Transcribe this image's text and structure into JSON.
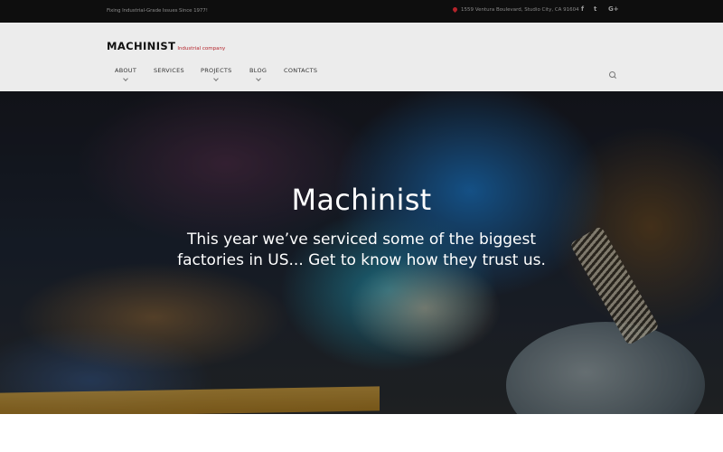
{
  "topbar": {
    "tagline": "Fixing Industrial-Grade Issues Since 1977!",
    "address": "1559 Ventura Boulevard, Studio City, CA 91604",
    "address_icon": "map-pin-icon",
    "social": [
      {
        "name": "facebook-icon",
        "glyph": "f"
      },
      {
        "name": "twitter-icon",
        "glyph": "t"
      },
      {
        "name": "google-plus-icon",
        "glyph": "G+"
      }
    ]
  },
  "header": {
    "brand": "MACHINIST",
    "brand_sub": "Industrial company",
    "nav": [
      {
        "label": "ABOUT",
        "has_dropdown": true
      },
      {
        "label": "SERVICES",
        "has_dropdown": false
      },
      {
        "label": "PROJECTS",
        "has_dropdown": true
      },
      {
        "label": "BLOG",
        "has_dropdown": true
      },
      {
        "label": "CONTACTS",
        "has_dropdown": false
      }
    ],
    "search_icon": "search-icon"
  },
  "hero": {
    "title": "Machinist",
    "subtitle": "This year we’ve serviced some of the biggest factories in US... Get to know how they trust us."
  },
  "colors": {
    "topbar_bg": "#0e0e0e",
    "header_bg": "#ececec",
    "accent": "#b4232a"
  }
}
